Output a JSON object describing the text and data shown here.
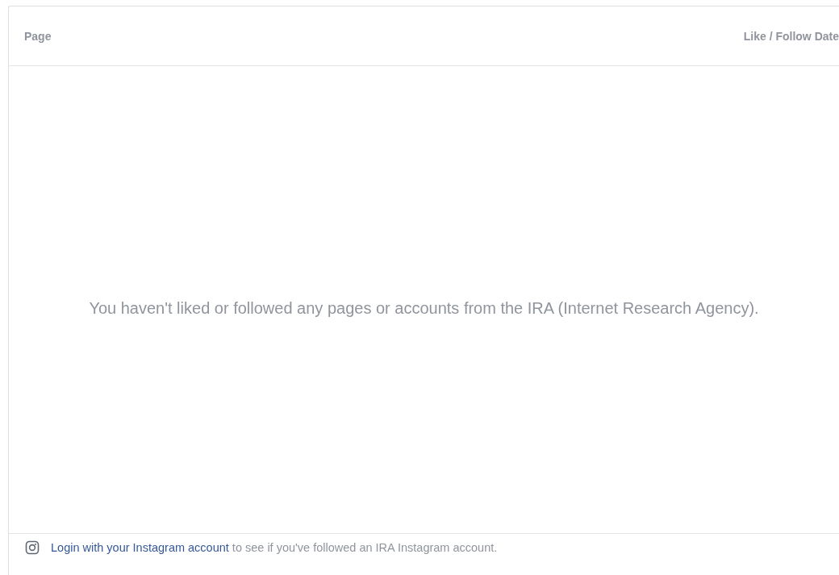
{
  "table": {
    "columns": [
      "Page",
      "Like / Follow Date"
    ],
    "empty_message": "You haven't liked or followed any pages or accounts from the IRA (Internet Research Agency)."
  },
  "footer": {
    "link": "Login with your Instagram account",
    "text": " to see if you've followed an IRA Instagram account."
  }
}
